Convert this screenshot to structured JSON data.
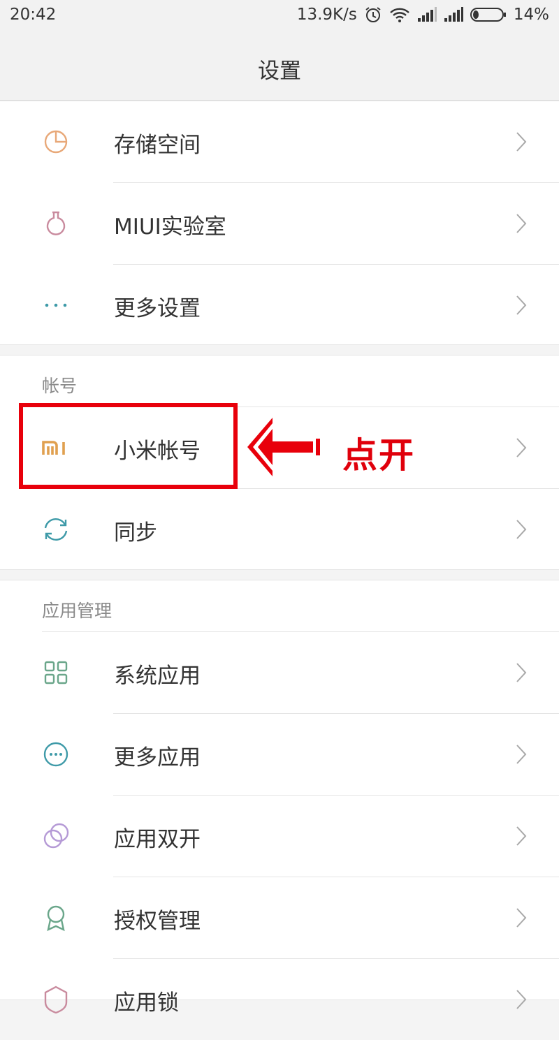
{
  "status_bar": {
    "time": "20:42",
    "network_speed": "13.9K/s",
    "battery_percent": "14%",
    "icons": [
      "alarm-icon",
      "wifi-icon",
      "signal-icon",
      "signal-icon",
      "battery-icon"
    ]
  },
  "header": {
    "title": "设置"
  },
  "sections": [
    {
      "header": "",
      "items": [
        {
          "label": "存储空间",
          "icon": "storage-pie-icon"
        },
        {
          "label": "MIUI实验室",
          "icon": "lab-flask-icon"
        },
        {
          "label": "更多设置",
          "icon": "more-dots-icon"
        }
      ]
    },
    {
      "header": "帐号",
      "items": [
        {
          "label": "小米帐号",
          "icon": "mi-logo-icon"
        },
        {
          "label": "同步",
          "icon": "sync-icon"
        }
      ]
    },
    {
      "header": "应用管理",
      "items": [
        {
          "label": "系统应用",
          "icon": "grid-apps-icon"
        },
        {
          "label": "更多应用",
          "icon": "more-circle-icon"
        },
        {
          "label": "应用双开",
          "icon": "dual-apps-icon"
        },
        {
          "label": "授权管理",
          "icon": "award-icon"
        },
        {
          "label": "应用锁",
          "icon": "app-lock-icon"
        }
      ]
    }
  ],
  "annotation": {
    "text": "点开",
    "color": "#e0000b"
  },
  "colors": {
    "accent_red": "#e8000b",
    "mi_orange": "#e0a04f",
    "storage_orange": "#e8a878",
    "lab_pink": "#c98b9e",
    "teal": "#3e9aa8",
    "green": "#6aa68a",
    "purple": "#b59ad6"
  }
}
